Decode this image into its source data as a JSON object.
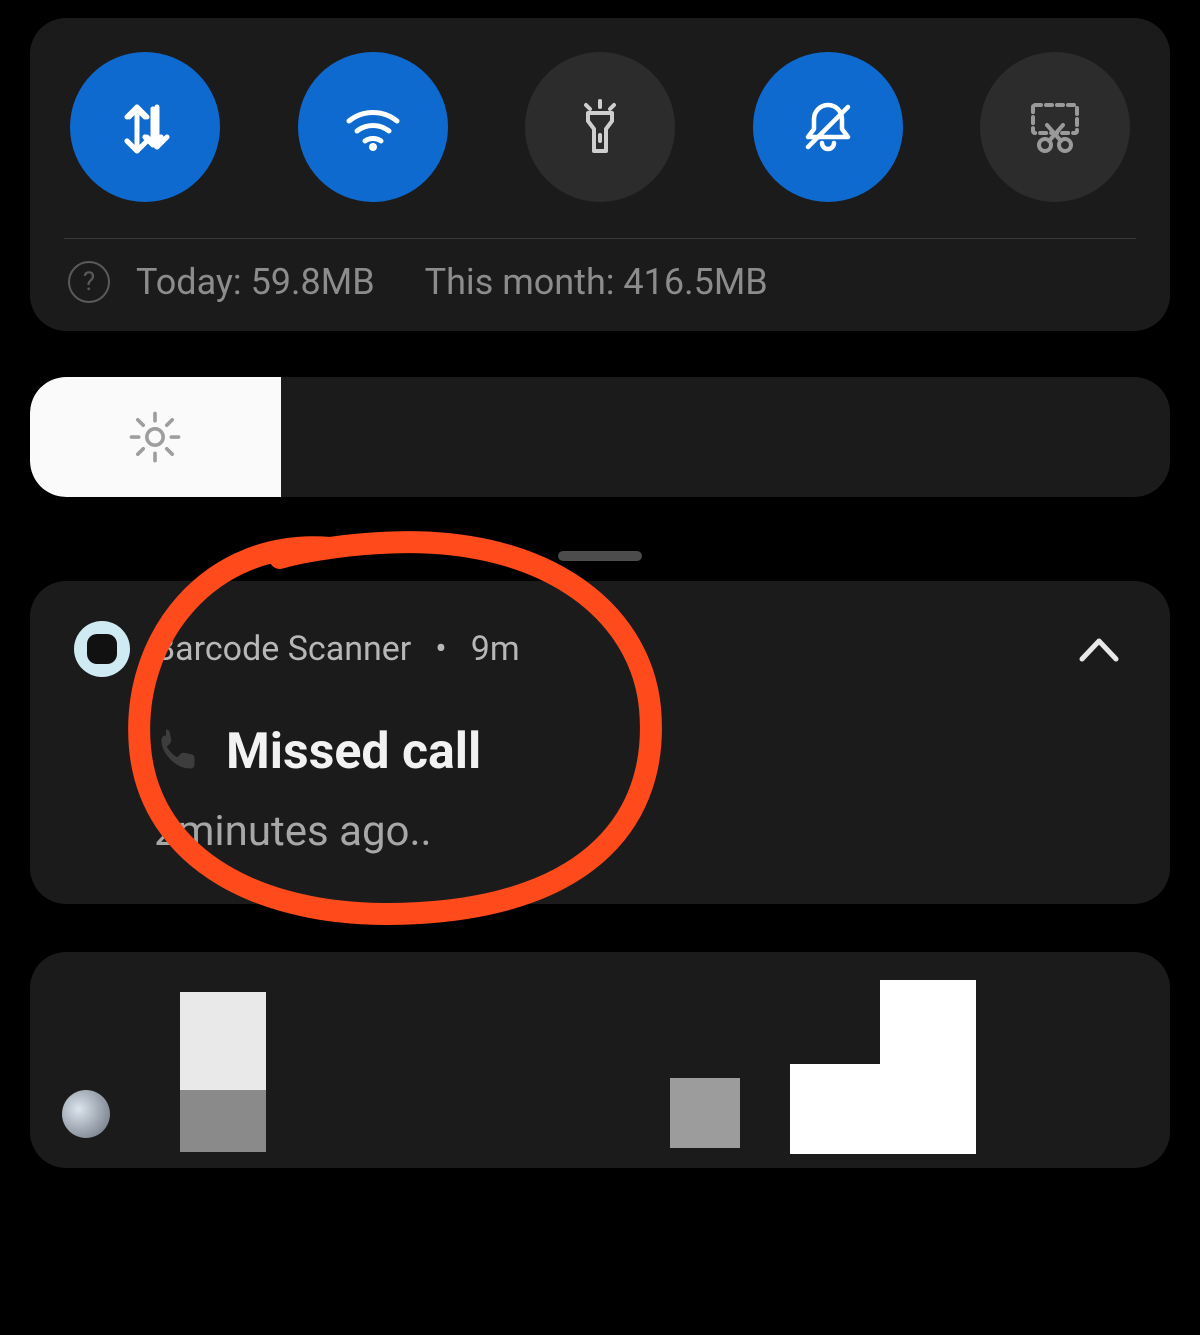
{
  "quick_settings": {
    "toggles": [
      {
        "name": "mobile-data",
        "active": true
      },
      {
        "name": "wifi",
        "active": true
      },
      {
        "name": "flashlight",
        "active": false
      },
      {
        "name": "dnd",
        "active": true
      },
      {
        "name": "screenshot",
        "active": false
      }
    ]
  },
  "data_usage": {
    "help_glyph": "?",
    "today_label": "Today: 59.8MB",
    "month_label": "This month: 416.5MB"
  },
  "brightness": {
    "percent": 22
  },
  "notification": {
    "app_name": "Barcode Scanner",
    "separator": "•",
    "age": "9m",
    "title": "Missed call",
    "subtitle": "2minutes ago.."
  },
  "annotation": {
    "color": "#ff4a1c"
  }
}
